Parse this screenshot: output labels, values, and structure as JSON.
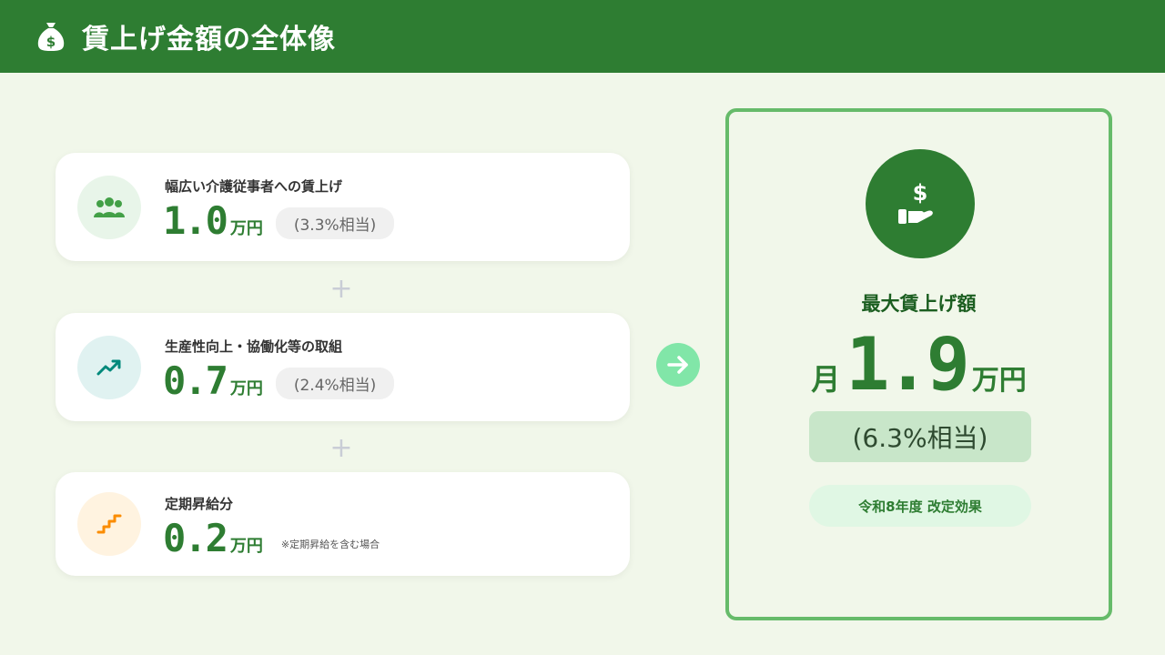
{
  "header": {
    "title": "賃上げ金額の全体像",
    "icon": "money-bag-icon"
  },
  "items": [
    {
      "label": "幅広い介護従事者への賃上げ",
      "value": "1.0",
      "unit": "万円",
      "ratio": "(3.3%相当)",
      "icon": "people-icon",
      "icon_bg": "#e8f5e9",
      "icon_color": "#43a047"
    },
    {
      "label": "生産性向上・協働化等の取組",
      "value": "0.7",
      "unit": "万円",
      "ratio": "(2.4%相当)",
      "icon": "trend-up-icon",
      "icon_bg": "#e0f2f1",
      "icon_color": "#00897b"
    },
    {
      "label": "定期昇給分",
      "value": "0.2",
      "unit": "万円",
      "note": "※定期昇給を含む場合",
      "icon": "stairs-icon",
      "icon_bg": "#fff3e0",
      "icon_color": "#fb8c00"
    }
  ],
  "plus_symbol": "+",
  "result": {
    "title": "最大賃上げ額",
    "prefix": "月",
    "value": "1.9",
    "unit": "万円",
    "ratio": "(6.3%相当)",
    "effect": "令和8年度 改定効果",
    "icon": "hand-money-icon"
  },
  "colors": {
    "primary": "#2e7d32",
    "accent_border": "#66bb6a",
    "arrow": "#81e6a8",
    "background": "#f1f7ea"
  }
}
